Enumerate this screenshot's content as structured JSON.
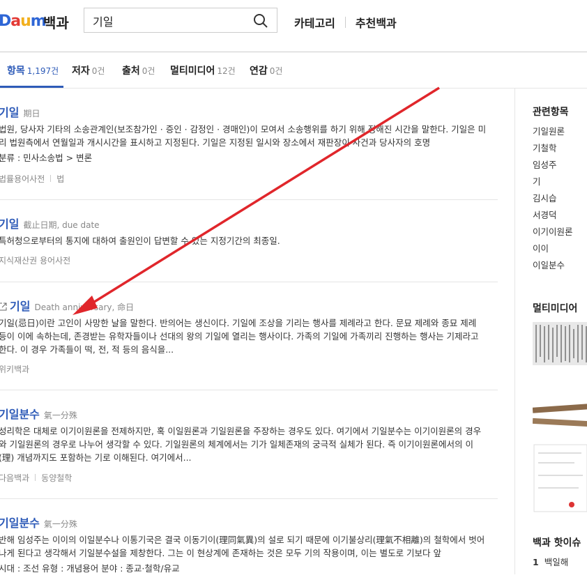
{
  "header": {
    "logo": "Daum",
    "logo_suffix": "백과",
    "search_value": "기일",
    "nav": [
      "카테고리",
      "추천백과"
    ]
  },
  "tabs": [
    {
      "label": "항목",
      "count": "1,197건"
    },
    {
      "label": "저자",
      "count": "0건"
    },
    {
      "label": "출처",
      "count": "0건"
    },
    {
      "label": "멀티미디어",
      "count": "12건"
    },
    {
      "label": "연감",
      "count": "0건"
    }
  ],
  "results": [
    {
      "title": "기일",
      "sub": "期日",
      "body": "법원, 당사자 기타의 소송관계인(보조참가인 · 증인 · 감정인 · 경매인)이 모여서 소송행위를 하기 위해 정해진 시간을 말한다. 기일은 미리 법원측에서 연월일과 개시시간을 표시하고 지정된다. 기일은 지정된 일시와 장소에서 재판장이 사건과 당사자의 호명",
      "extra": "분류 : 민사소송법 > 변론",
      "meta": [
        "법률용어사전",
        "법"
      ]
    },
    {
      "title": "기일",
      "sub": "截止日期, due date",
      "body": "특허청으로부터의 통지에 대하여 출원인이 답변할 수 있는 지정기간의 최종일.",
      "extra": "",
      "meta": [
        "지식재산권 용어사전"
      ]
    },
    {
      "title": "기일",
      "sub": "Death anniversary, 命日",
      "body": "기일(忌日)이란 고인이 사망한 날을 말한다. 반의어는 생신이다. 기일에 조상을 기리는 행사를 제례라고 한다. 문묘 제례와 종묘 제례 등이 이에 속하는데, 존경받는 유학자들이나 선대의 왕의 기일에 열리는 행사이다. 가족의 기일에 가족끼리 진행하는 행사는 기제라고 한다. 이 경우 가족들이 떡, 전, 적 등의 음식을...",
      "extra": "",
      "meta": [
        "위키백과"
      ]
    },
    {
      "title": "기일분수",
      "sub": "氣一分殊",
      "body": "성리학은 대체로 이기이원론을 전제하지만, 혹 이일원론과 기일원론을 주장하는 경우도 있다. 여기에서 기일분수는 이기이원론의 경우와 기일원론의 경우로 나누어 생각할 수 있다. 기일원론의 체계에서는 기가 일체존재의 궁극적 실체가 된다. 즉 이기이원론에서의 이(理) 개념까지도 포함하는 기로 이해된다. 여기에서...",
      "extra": "",
      "meta": [
        "다음백과",
        "동양철학"
      ]
    },
    {
      "title": "기일분수",
      "sub": "氣一分殊",
      "body": "반해 임성주는 이이의 이일분수나 이통기국은 결국 이동기이(理同氣異)의 설로 되기 때문에 이기불상리(理氣不相離)의 철학에서 벗어나게 된다고 생각해서 기일분수설을 제창한다. 그는 이 현상계에 존재하는 것은 모두 기의 작용이며, 이는 별도로 기보다 앞",
      "extra": "시대 : 조선    유형 : 개념용어    분야 : 종교·철학/유교",
      "meta": []
    }
  ],
  "sidebar": {
    "related_title": "관련항목",
    "related": [
      "기일원론",
      "기철학",
      "임성주",
      "기",
      "김시습",
      "서경덕",
      "이기이원론",
      "이이",
      "이일분수"
    ],
    "multimedia_title": "멀티미디어",
    "popular_title": "백과 핫이슈",
    "popular": [
      {
        "rank": "1",
        "label": "백일해"
      }
    ]
  },
  "colors": {
    "link": "#2e5bb8",
    "arrow": "#e0262b"
  }
}
